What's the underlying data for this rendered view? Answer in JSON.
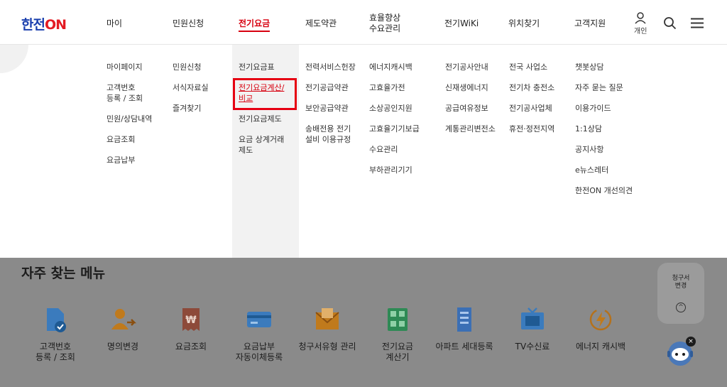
{
  "header": {
    "logo_text": "한전",
    "logo_on": "ON",
    "nav": [
      {
        "label": "마이"
      },
      {
        "label": "민원신청"
      },
      {
        "label": "전기요금"
      },
      {
        "label": "제도약관"
      },
      {
        "label_line1": "효율향상",
        "label_line2": "수요관리"
      },
      {
        "label": "전기WiKi"
      },
      {
        "label": "위치찾기"
      },
      {
        "label": "고객지원"
      }
    ],
    "user_label": "개인"
  },
  "mega_menu": {
    "columns": [
      {
        "items": [
          "마이페이지",
          "고객번호\n등록 / 조회",
          "민원/상담내역",
          "요금조회",
          "요금납부"
        ]
      },
      {
        "items": [
          "민원신청",
          "서식자료실",
          "즐겨찾기"
        ]
      },
      {
        "items": [
          "전기요금표",
          "전기요금계산/\n비교",
          "전기요금제도",
          "요금 상계거래\n제도"
        ]
      },
      {
        "items": [
          "전력서비스헌장",
          "전기공급약관",
          "보안공급약관",
          "송배전용 전기\n설비 이용규정"
        ]
      },
      {
        "items": [
          "에너지캐시백",
          "고효율가전",
          "소상공인지원",
          "고효율기기보급",
          "수요관리",
          "부하관리기기"
        ]
      },
      {
        "items": [
          "전기공사안내",
          "신재생에너지",
          "공급여유정보",
          "계통관리변전소"
        ]
      },
      {
        "items": [
          "전국 사업소",
          "전기차 충전소",
          "전기공사업체",
          "휴전·정전지역"
        ]
      },
      {
        "items": [
          "챗봇상담",
          "자주 묻는 질문",
          "이용가이드",
          "1:1상담",
          "공지사항",
          "e뉴스레터",
          "한전ON 개선의견"
        ]
      }
    ]
  },
  "favorites": {
    "title": "자주 찾는 메뉴",
    "items": [
      {
        "label": "고객번호\n등록 / 조회",
        "icon": "document-check-icon"
      },
      {
        "label": "명의변경",
        "icon": "person-transfer-icon"
      },
      {
        "label": "요금조회",
        "icon": "won-receipt-icon"
      },
      {
        "label": "요금납부\n자동이체등록",
        "icon": "card-icon"
      },
      {
        "label": "청구서유형 관리",
        "icon": "envelope-icon"
      },
      {
        "label": "전기요금\n계산기",
        "icon": "calculator-icon"
      },
      {
        "label": "아파트 세대등록",
        "icon": "apartment-icon"
      },
      {
        "label": "TV수신료",
        "icon": "tv-icon"
      },
      {
        "label": "에너지 캐시백",
        "icon": "energy-cashback-icon"
      }
    ]
  },
  "floating": {
    "bill_change_line1": "청구서",
    "bill_change_line2": "변경",
    "up_symbol": "^",
    "close_symbol": "×"
  },
  "colors": {
    "brand_blue": "#1a3fae",
    "brand_red": "#e31b23",
    "active_red": "#d7000f"
  }
}
